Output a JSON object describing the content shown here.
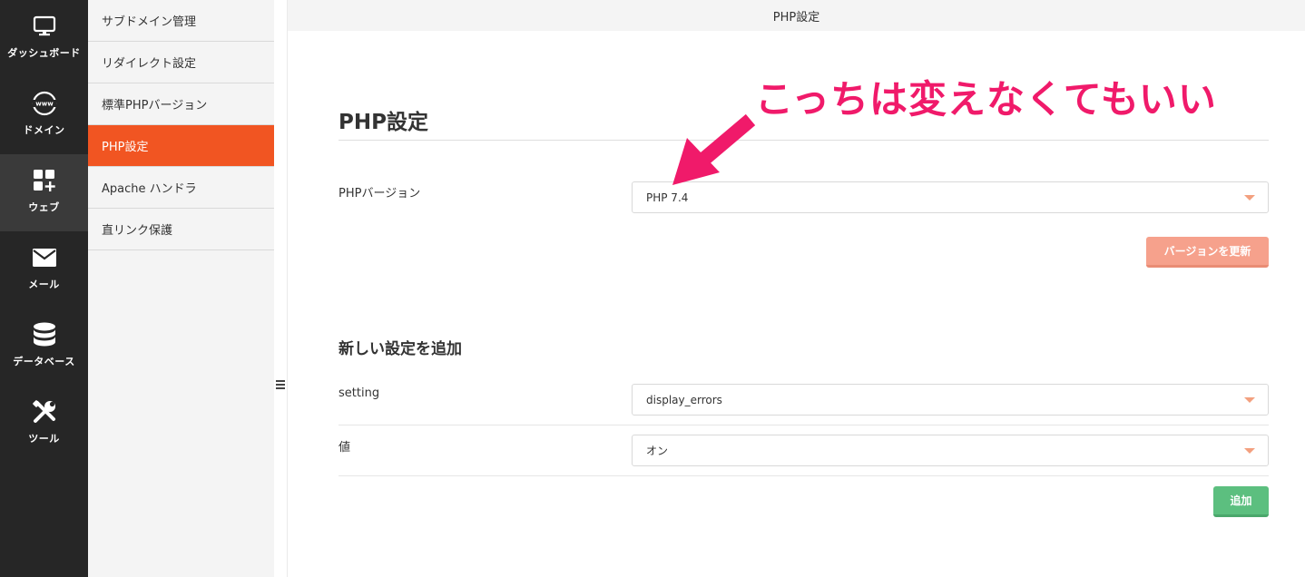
{
  "rail": {
    "items": [
      {
        "label": "ダッシュボード",
        "icon": "monitor-icon"
      },
      {
        "label": "ドメイン",
        "icon": "www-globe-icon"
      },
      {
        "label": "ウェブ",
        "icon": "grid-plus-icon",
        "active": true
      },
      {
        "label": "メール",
        "icon": "envelope-icon"
      },
      {
        "label": "データベース",
        "icon": "database-icon"
      },
      {
        "label": "ツール",
        "icon": "tools-icon"
      }
    ]
  },
  "submenu": {
    "items": [
      {
        "label": "サブドメイン管理"
      },
      {
        "label": "リダイレクト設定"
      },
      {
        "label": "標準PHPバージョン"
      },
      {
        "label": "PHP設定",
        "active": true
      },
      {
        "label": "Apache ハンドラ"
      },
      {
        "label": "直リンク保護"
      }
    ]
  },
  "topbar": {
    "title": "PHP設定"
  },
  "main": {
    "title": "PHP設定",
    "php_version": {
      "label": "PHPバージョン",
      "value": "PHP 7.4"
    },
    "update_button": "バージョンを更新",
    "add_section": {
      "title": "新しい設定を追加",
      "setting": {
        "label": "setting",
        "value": "display_errors"
      },
      "value": {
        "label": "値",
        "value": "オン"
      },
      "add_button": "追加"
    }
  },
  "annotation": {
    "text": "こっちは変えなくてもいい",
    "color": "#f01a6a"
  },
  "colors": {
    "accent": "#f15522",
    "rail_bg": "#262626",
    "add_green": "#5cbf7f",
    "update_salmon": "#f6a18c"
  }
}
